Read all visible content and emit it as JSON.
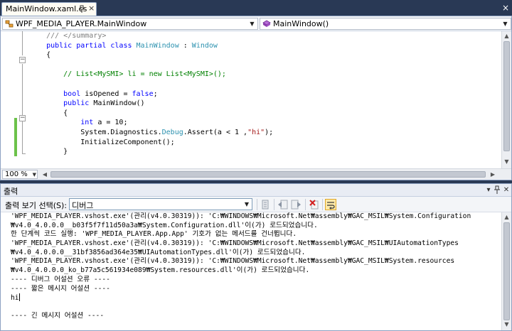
{
  "editor": {
    "tab_title": "MainWindow.xaml.cs",
    "tab_close": "×",
    "type_combo": "WPF_MEDIA_PLAYER.MainWindow",
    "member_combo": "MainWindow()",
    "zoom": "100 %",
    "lines": [
      [
        {
          "t": "    /// </summary>",
          "c": "dc"
        }
      ],
      [
        {
          "t": "    public partial class ",
          "c": "kw"
        },
        {
          "t": "MainWindow",
          "c": "ty"
        },
        {
          "t": " : ",
          "c": ""
        },
        {
          "t": "Window",
          "c": "ty"
        }
      ],
      [
        {
          "t": "    {",
          "c": ""
        }
      ],
      [
        {
          "t": "",
          "c": ""
        }
      ],
      [
        {
          "t": "        // List<MySMI> li = new List<MySMI>();",
          "c": "cm"
        }
      ],
      [
        {
          "t": "",
          "c": ""
        }
      ],
      [
        {
          "t": "        bool",
          "c": "kw"
        },
        {
          "t": " isOpened = ",
          "c": ""
        },
        {
          "t": "false",
          "c": "kw"
        },
        {
          "t": ";",
          "c": ""
        }
      ],
      [
        {
          "t": "        public",
          "c": "kw"
        },
        {
          "t": " MainWindow()",
          "c": ""
        }
      ],
      [
        {
          "t": "        {",
          "c": ""
        }
      ],
      [
        {
          "t": "            int",
          "c": "kw"
        },
        {
          "t": " a = 10;",
          "c": ""
        }
      ],
      [
        {
          "t": "            System.Diagnostics.",
          "c": ""
        },
        {
          "t": "Debug",
          "c": "ty"
        },
        {
          "t": ".Assert(a < 1 ,",
          "c": ""
        },
        {
          "t": "\"hi\"",
          "c": "st"
        },
        {
          "t": ");",
          "c": ""
        }
      ],
      [
        {
          "t": "            InitializeComponent();",
          "c": ""
        }
      ],
      [
        {
          "t": "        }",
          "c": ""
        }
      ],
      [
        {
          "t": "",
          "c": ""
        }
      ]
    ]
  },
  "output": {
    "title": "출력",
    "show_output_label": "출력 보기 선택(S):",
    "source": "디버그",
    "lines": [
      "'WPF_MEDIA_PLAYER.vshost.exe'(관리(v4.0.30319)): 'C:₩WINDOWS₩Microsoft.Net₩assembly₩GAC_MSIL₩System.Configuration",
      "₩v4.0_4.0.0.0__b03f5f7f11d50a3a₩System.Configuration.dll'이(가) 로드되었습니다.",
      "한 단계씩 코드 실행: 'WPF_MEDIA_PLAYER.App.App' 기호가 없는 메서드를 건너뜁니다.",
      "'WPF_MEDIA_PLAYER.vshost.exe'(관리(v4.0.30319)): 'C:₩WINDOWS₩Microsoft.Net₩assembly₩GAC_MSIL₩UIAutomationTypes",
      "₩v4.0_4.0.0.0__31bf3856ad364e35₩UIAutomationTypes.dll'이(가) 로드되었습니다.",
      "'WPF_MEDIA_PLAYER.vshost.exe'(관리(v4.0.30319)): 'C:₩WINDOWS₩Microsoft.Net₩assembly₩GAC_MSIL₩System.resources",
      "₩v4.0_4.0.0.0_ko_b77a5c561934e089₩System.resources.dll'이(가) 로드되었습니다.",
      "---- 디버그 어설션 오류 ----",
      "---- 짧은 메시지 어설션 ----",
      "hi",
      "",
      "---- 긴 메시지 어설션 ----"
    ]
  },
  "colors": {
    "window_frame": "#293955",
    "keyword": "#0000ff",
    "type": "#2b91af",
    "comment": "#008000",
    "string": "#a31515",
    "change_marker": "#6cc24a"
  },
  "icons": [
    "pin-icon",
    "close-icon",
    "class-icon",
    "method-icon",
    "find-source-icon",
    "prev-message-icon",
    "next-message-icon",
    "clear-all-icon",
    "word-wrap-icon"
  ]
}
